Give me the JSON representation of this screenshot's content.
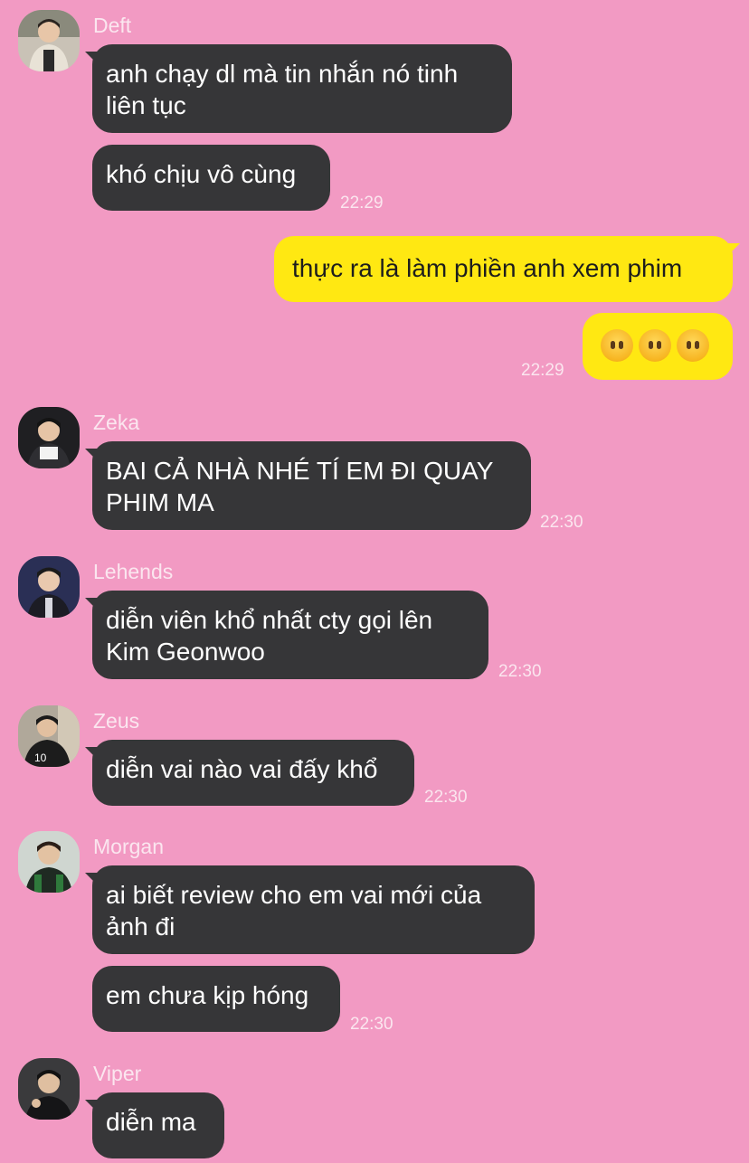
{
  "messages": [
    {
      "sender": "Deft",
      "bubbles": [
        "anh chạy dl mà tin nhắn nó tinh\nliên tục",
        "khó chịu vô cùng"
      ],
      "time": "22:29"
    },
    {
      "me": true,
      "bubbles": [
        "thực ra là làm phiền anh xem phim"
      ],
      "emoji_bubble": [
        "neutral-face-emoji",
        "neutral-face-emoji",
        "neutral-face-emoji"
      ],
      "time": "22:29"
    },
    {
      "sender": "Zeka",
      "bubbles": [
        "BAI CẢ NHÀ NHÉ TÍ EM ĐI QUAY\nPHIM MA"
      ],
      "time": "22:30"
    },
    {
      "sender": "Lehends",
      "bubbles": [
        "diễn viên khổ nhất cty gọi lên\nKim Geonwoo"
      ],
      "time": "22:30"
    },
    {
      "sender": "Zeus",
      "bubbles": [
        "diễn vai nào vai đấy khổ"
      ],
      "time": "22:30"
    },
    {
      "sender": "Morgan",
      "bubbles": [
        "ai biết review cho em vai mới của\nảnh đi",
        "em chưa kịp hóng"
      ],
      "time": "22:30"
    },
    {
      "sender": "Viper",
      "bubbles": [
        "diễn ma"
      ]
    }
  ],
  "colors": {
    "background": "#f29ac3",
    "their_bubble": "#363638",
    "my_bubble": "#ffe812"
  }
}
